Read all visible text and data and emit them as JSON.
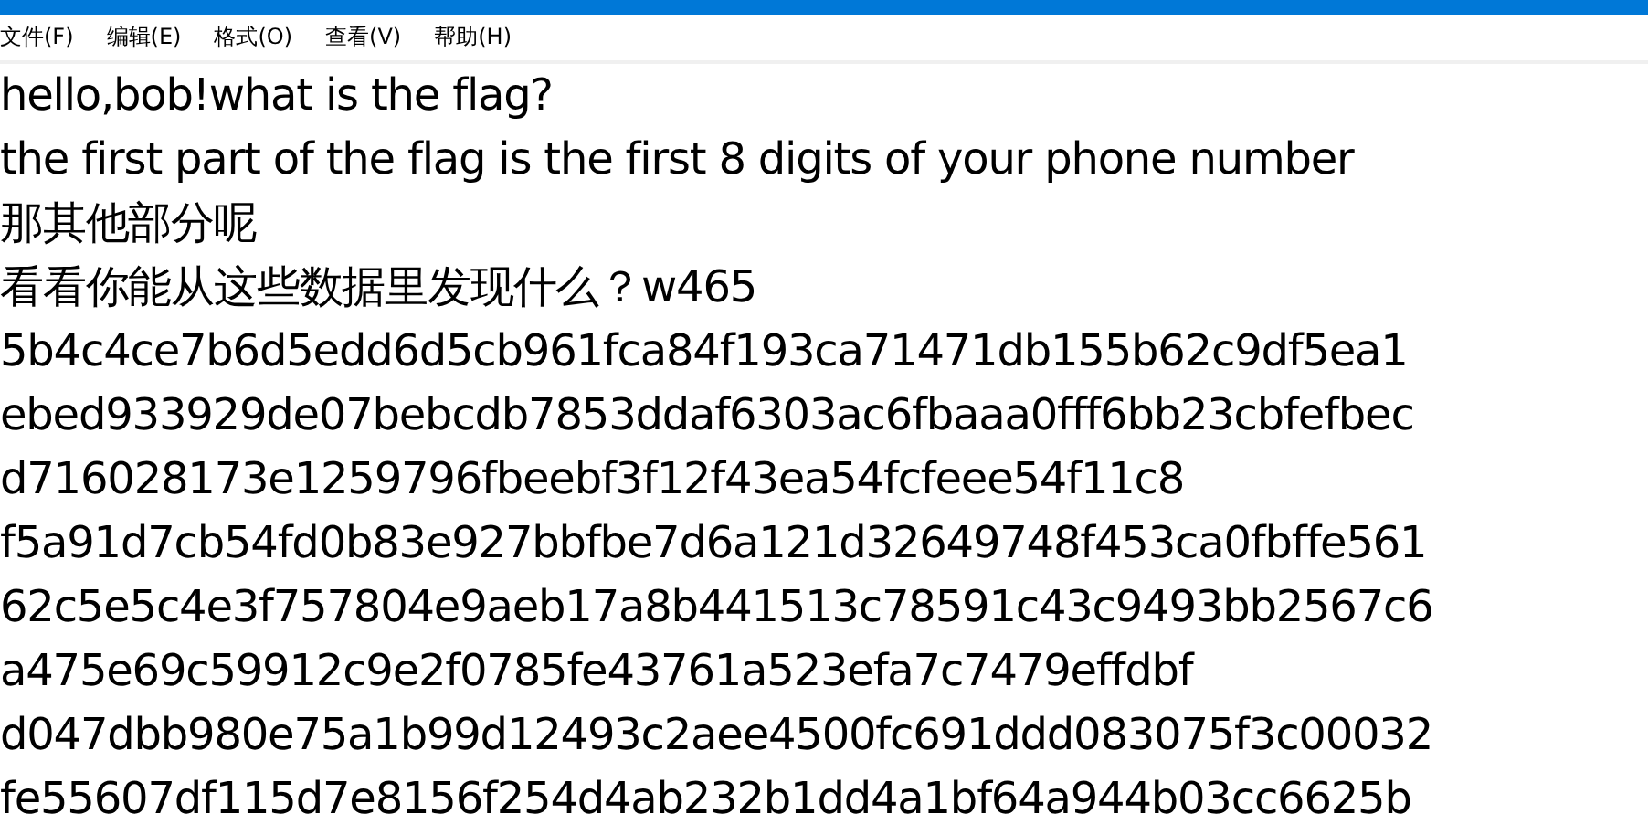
{
  "menu": [
    "文件(F)",
    "编辑(E)",
    "格式(O)",
    "查看(V)",
    "帮助(H)"
  ],
  "lines": [
    "hello,bob!what is the flag?",
    "the first part of the flag is the first 8 digits of your phone number",
    "那其他部分呢",
    "看看你能从这些数据里发现什么？w465",
    "5b4c4ce7b6d5edd6d5cb961fca84f193ca71471db155b62c9df5ea1",
    "ebed933929de07bebcdb7853ddaf6303ac6fbaaa0fff6bb23cbfefbec",
    "d716028173e1259796fbeebf3f12f43ea54fcfeee54f11c8",
    "f5a91d7cb54fd0b83e927bbfbe7d6a121d32649748f453ca0fbffe561",
    "62c5e5c4e3f757804e9aeb17a8b441513c78591c43c9493bb2567c6",
    "a475e69c59912c9e2f0785fe43761a523efa7c7479effdbf",
    "d047dbb980e75a1b99d12493c2aee4500fc691ddd083075f3c00032",
    "fe55607df115d7e8156f254d4ab232b1dd4a1bf64a944b03cc6625b"
  ]
}
